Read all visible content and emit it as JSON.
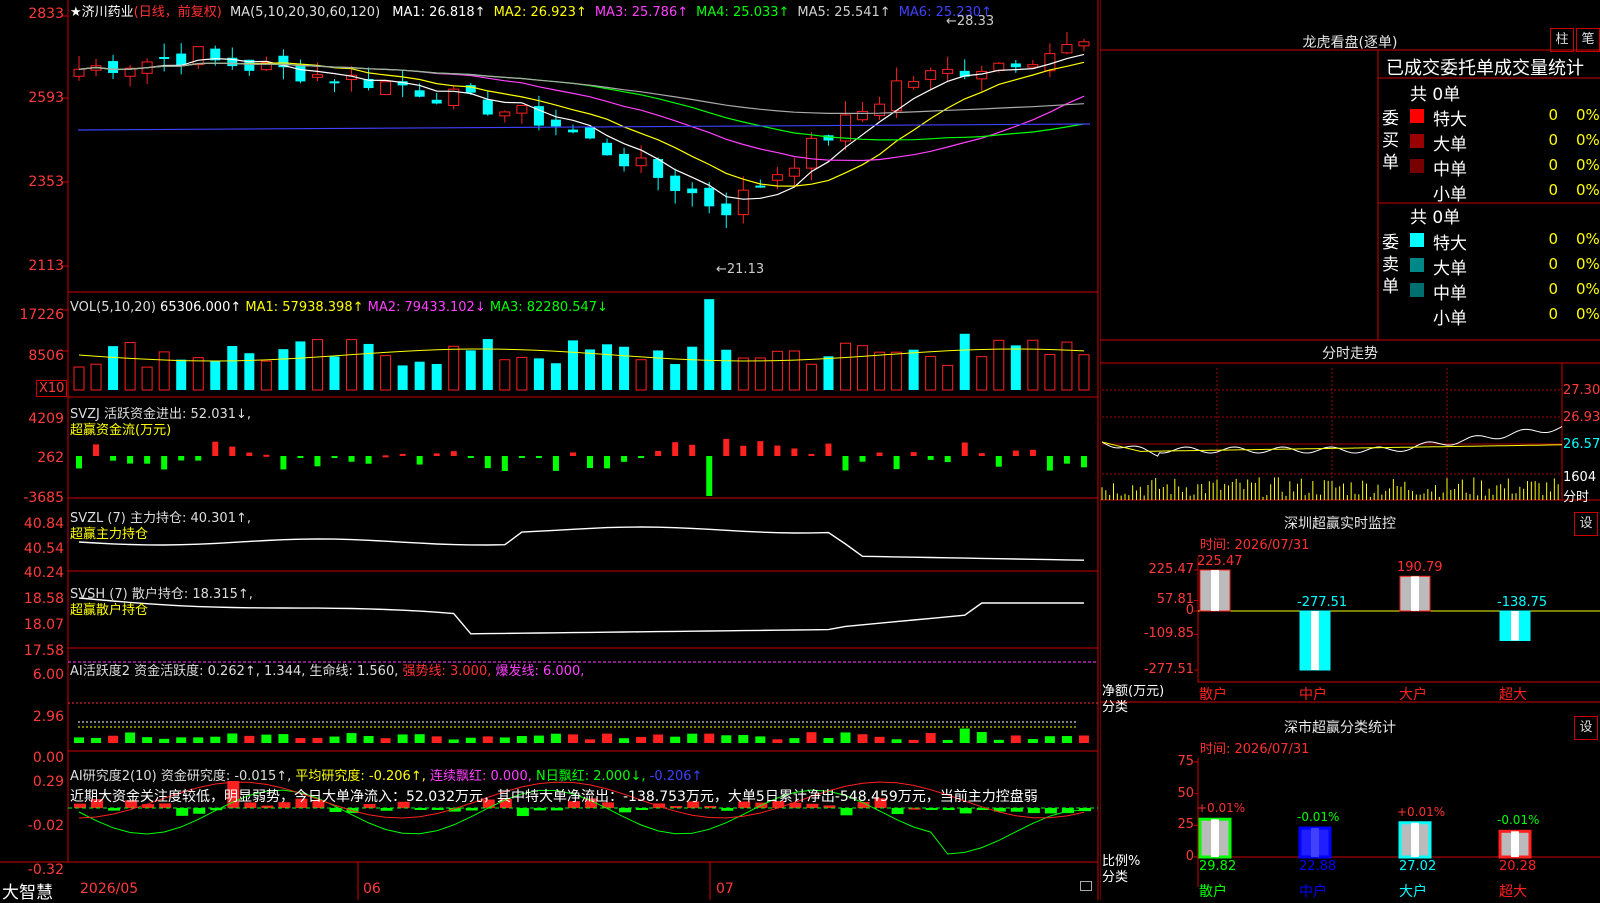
{
  "header": {
    "star": "★",
    "stock": "济川药业",
    "mode": "(日线，前复权)",
    "ma_text": "MA(5,10,20,30,60,120)",
    "mas": [
      {
        "label": "MA1: 26.818↑",
        "color": "#ffffff"
      },
      {
        "label": "MA2: 26.923↑",
        "color": "#ffff00"
      },
      {
        "label": "MA3: 25.786↑",
        "color": "#ff40ff"
      },
      {
        "label": "MA4: 25.033↑",
        "color": "#00ff00"
      },
      {
        "label": "MA5: 25.541↑",
        "color": "#d0d0d0"
      },
      {
        "label": "MA6: 25.230↑",
        "color": "#4040ff"
      }
    ],
    "high_mark": "←28.33",
    "low_mark": "←21.13"
  },
  "price_axis": [
    "2833",
    "2593",
    "2353",
    "2113"
  ],
  "vol_panel": {
    "label": "VOL(5,10,20)",
    "value": "65306.000↑",
    "ma1": "MA1: 57938.398↑",
    "ma2": "MA2: 79433.102↓",
    "ma3": "MA3: 82280.547↓",
    "axis": [
      "17226",
      "8506"
    ],
    "unit": "X10"
  },
  "svzj": {
    "line1": "SVZJ  活跃资金进出: 52.031↓,",
    "line2": "超赢资金流(万元)",
    "axis": [
      "4209",
      "262",
      "-3685"
    ]
  },
  "svzl": {
    "line1": "SVZL (7) 主力持仓: 40.301↑,",
    "line2": "超赢主力持仓",
    "axis": [
      "40.84",
      "40.54",
      "40.24"
    ]
  },
  "svsh": {
    "line1": "SVSH (7) 散户持仓: 18.315↑,",
    "line2": "超赢散户持仓",
    "axis": [
      "18.58",
      "18.07",
      "17.58"
    ]
  },
  "ai1": {
    "label": "AI活跃度2 资金活跃度: 0.262↑, 1.344, 生命线: 1.560,",
    "strong": "强势线: 3.000,",
    "burst": "爆发线: 6.000,",
    "axis": [
      "6.00",
      "2.96",
      "0.00"
    ]
  },
  "ai2": {
    "label": "AI研究度2(10) 资金研究度: -0.015↑,",
    "avg": "平均研究度: -0.206↑,",
    "streak": "连续飘红: 0.000,",
    "ndays": "N日飘红: 2.000↓,",
    "neg": "-0.206↑",
    "desc": "近期大资金关注度较低，明显弱势，今日大单净流入：52.032万元，其中特大单净流出：-138.753万元，大单5日累计净出-548.459万元，当前主力控盘弱",
    "axis": [
      "0.29",
      "-0.02",
      "-0.32"
    ]
  },
  "date_axis": [
    "2026/05",
    "06",
    "07"
  ],
  "brand": "大智慧",
  "right": {
    "lhb_title": "龙虎看盘(逐单)",
    "btn_bar": "柱",
    "btn_count": "笔",
    "tabs": "已成交委托单成交量统计",
    "buy": {
      "side_label": "委买单",
      "total": "共 0单",
      "rows": [
        {
          "label": "特大",
          "value": "0",
          "pct": "0%",
          "color": "#ff0000"
        },
        {
          "label": "大单",
          "value": "0",
          "pct": "0%",
          "color": "#990000"
        },
        {
          "label": "中单",
          "value": "0",
          "pct": "0%",
          "color": "#770000"
        },
        {
          "label": "小单",
          "value": "0",
          "pct": "0%",
          "color": "#000000"
        }
      ]
    },
    "sell": {
      "side_label": "委卖单",
      "total": "共 0单",
      "rows": [
        {
          "label": "特大",
          "value": "0",
          "pct": "0%",
          "color": "#00ffff"
        },
        {
          "label": "大单",
          "value": "0",
          "pct": "0%",
          "color": "#008888"
        },
        {
          "label": "中单",
          "value": "0",
          "pct": "0%",
          "color": "#006f6f"
        },
        {
          "label": "小单",
          "value": "0",
          "pct": "0%",
          "color": "#000000"
        }
      ]
    },
    "intraday": {
      "title": "分时走势",
      "axis": [
        "27.30",
        "26.93",
        "26.57"
      ],
      "vol_label": "1604",
      "time_label": "分时"
    },
    "monitor": {
      "title": "深圳超赢实时监控",
      "set": "设",
      "time": "时间: 2026/07/31",
      "axis": [
        "225.47",
        "57.81",
        "0",
        "-109.85",
        "-277.51"
      ],
      "ylabel1": "净额(万元)",
      "ylabel2": "分类",
      "bars": [
        {
          "name": "散户",
          "label": "225.47",
          "value": 225.47
        },
        {
          "name": "中户",
          "label": "-277.51",
          "value": -277.51
        },
        {
          "name": "大户",
          "label": "190.79",
          "value": 190.79
        },
        {
          "name": "超大",
          "label": "-138.75",
          "value": -138.75
        }
      ]
    },
    "stats": {
      "title": "深市超赢分类统计",
      "set": "设",
      "time": "时间: 2026/07/31",
      "axis": [
        "75",
        "50",
        "25",
        "0"
      ],
      "ylabel1": "比例%",
      "ylabel2": "分类",
      "bars": [
        {
          "name": "散户",
          "label": "29.82",
          "delta": "+0.01%",
          "value": 29.82
        },
        {
          "name": "中户",
          "label": "22.88",
          "delta": "-0.01%",
          "value": 22.88
        },
        {
          "name": "大户",
          "label": "27.02",
          "delta": "+0.01%",
          "value": 27.02
        },
        {
          "name": "超大",
          "label": "20.28",
          "delta": "-0.01%",
          "value": 20.28
        }
      ]
    }
  }
}
